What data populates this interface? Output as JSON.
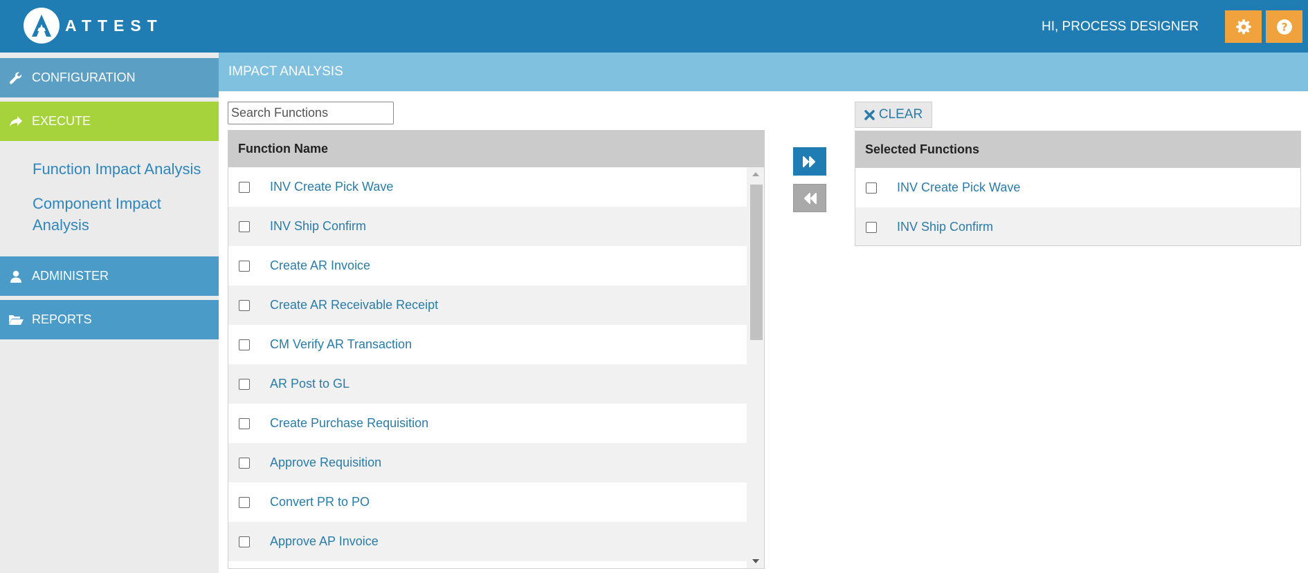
{
  "app": {
    "logo_text": "ATTEST",
    "greeting": "HI, PROCESS DESIGNER"
  },
  "header": {
    "settings_icon": "gear-icon",
    "help_icon": "question-circle-icon"
  },
  "sidebar": {
    "configuration": "CONFIGURATION",
    "execute": "EXECUTE",
    "function_impact": "Function Impact Analysis",
    "component_impact": "Component Impact Analysis",
    "administer": "ADMINISTER",
    "reports": "REPORTS"
  },
  "page": {
    "title": "IMPACT ANALYSIS"
  },
  "search": {
    "placeholder": "Search Functions",
    "value": ""
  },
  "available": {
    "header": "Function Name",
    "rows": [
      "INV Create Pick Wave",
      "INV Ship Confirm",
      "Create AR Invoice",
      "Create AR Receivable Receipt",
      "CM Verify AR Transaction",
      "AR Post to GL",
      "Create Purchase Requisition",
      "Approve Requisition",
      "Convert PR to PO",
      "Approve AP Invoice"
    ]
  },
  "selected": {
    "clear_label": "CLEAR",
    "header": "Selected Functions",
    "rows": [
      "INV Create Pick Wave",
      "INV Ship Confirm"
    ]
  },
  "colors": {
    "header_bg": "#1f7db3",
    "accent_orange": "#f0a23c",
    "execute_green": "#a6d33c",
    "title_bar": "#80c1e0",
    "link": "#2a7ba8"
  }
}
